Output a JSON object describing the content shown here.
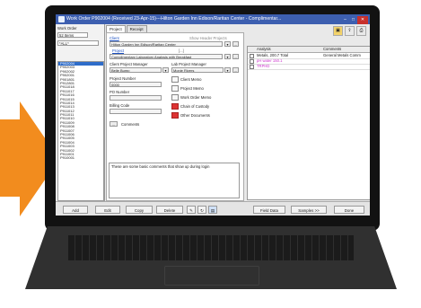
{
  "window": {
    "title": "Work Order P902004 (Received 23-Apr-15)---Hilton Garden Inn Edison/Raritan Center - Complimentar..."
  },
  "left_panel": {
    "heading": "Work Order",
    "count": "52 Items",
    "filter": "*ALL*",
    "work_orders": [
      "P902004",
      "P902003",
      "P902002",
      "P902001",
      "P901801",
      "P912801",
      "P911018",
      "P911017",
      "P911016",
      "P911015",
      "P911014",
      "P911013",
      "P911012",
      "P911011",
      "P911010",
      "P911009",
      "P911008",
      "P911007",
      "P911006",
      "P911005",
      "P911004",
      "P911003",
      "P911002",
      "P911001",
      "P910001"
    ],
    "selected": "P902004"
  },
  "tabs": [
    "Project",
    "Receipt"
  ],
  "form": {
    "client_label": "Client",
    "show_header": "Show Header Projects",
    "client_value": "Hilton Garden Inn Edison/Raritan Center",
    "project_label": "Project",
    "project_option": "[...]",
    "project_value": "Complimentary Laboratory Analysis with Breakfast",
    "client_pm_label": "Client Project Manager",
    "lab_pm_label": "Lab Project Manager",
    "client_pm_value": "Belle Bump",
    "lab_pm_value": "Monie Rivers",
    "project_number_label": "Project Number",
    "project_number_value": "0000",
    "po_number_label": "PO Number",
    "billing_code_label": "Billing Code",
    "comments_label": "Comments",
    "comments_value": "These are some basic comments that show up during login",
    "doc_buttons": [
      "Client Memo",
      "Project Memo",
      "Work Order Memo",
      "Chain of Custody",
      "Other Documents"
    ]
  },
  "grid": {
    "headers": [
      "Analysis",
      "Comments"
    ],
    "rows": [
      {
        "analysis": "Metals, 200.7 Total",
        "comments": "General Metals Comm"
      },
      {
        "analysis": "pH water 150.1",
        "comments": ""
      },
      {
        "analysis": "TRPHD",
        "comments": ""
      }
    ],
    "row_colors": [
      "#222222",
      "#cc33cc",
      "#cc33cc"
    ]
  },
  "bottom_bar": {
    "add": "Add",
    "edit": "Edit",
    "copy": "Copy",
    "delete": "Delete",
    "field_data": "Field Data",
    "samples": "Samples >>",
    "done": "Done"
  },
  "colors": {
    "accent_orange": "#f28c1e",
    "titlebar": "#3d5fb0",
    "selection": "#2e6cc9"
  }
}
